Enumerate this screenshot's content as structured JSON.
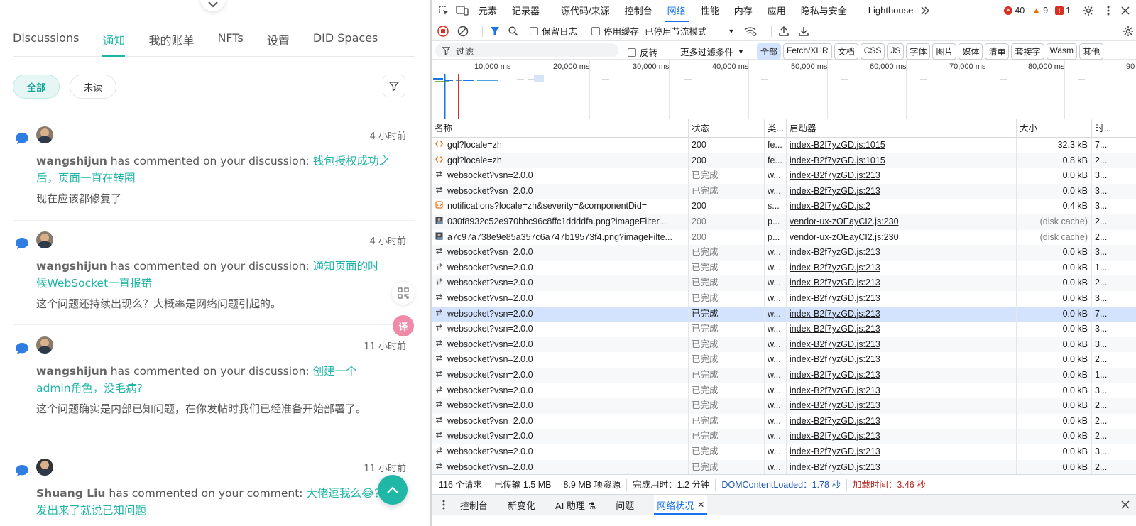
{
  "left": {
    "tabs": [
      "Discussions",
      "通知",
      "我的账单",
      "NFTs",
      "设置",
      "DID Spaces"
    ],
    "filters": {
      "all": "全部",
      "unread": "未读"
    },
    "notifications": [
      {
        "time": "4 小时前",
        "user": "wangshijun",
        "action": " has commented on your discussion: ",
        "link": "钱包授权成功之后，页面一直在转圈",
        "reply": "现在应该都修复了"
      },
      {
        "time": "4 小时前",
        "user": "wangshijun",
        "action": " has commented on your discussion: ",
        "link": "通知页面的时候WebSocket一直报错",
        "reply": "这个问题还持续出现么？大概率是网络问题引起的。"
      },
      {
        "time": "11 小时前",
        "user": "wangshijun",
        "action": " has commented on your discussion: ",
        "link": "创建一个admin角色，没毛病?",
        "reply": "这个问题确实是内部已知问题，在你发帖时我们已经准备开始部署了。"
      },
      {
        "time": "11 小时前",
        "user": "Shuang Liu",
        "action": " has commented on your comment: ",
        "link": "大佬逗我么😂？发出来了就说已知问题",
        "reply": ""
      }
    ],
    "translate_label": "译"
  },
  "devtools": {
    "tabs": [
      "元素",
      "记录器",
      "源代码/来源",
      "控制台",
      "网络",
      "性能",
      "内存",
      "应用",
      "隐私与安全",
      "Lighthouse"
    ],
    "active_tab": "网络",
    "badges": {
      "errors": "40",
      "warnings": "9",
      "issues": "1"
    },
    "toolbar2": {
      "preserve_log": "保留日志",
      "disable_cache": "停用缓存",
      "throttle": "已停用节流模式"
    },
    "filter": {
      "placeholder": "过滤",
      "invert": "反转",
      "more_filters": "更多过滤条件"
    },
    "filter_types": [
      "全部",
      "Fetch/XHR",
      "文档",
      "CSS",
      "JS",
      "字体",
      "图片",
      "媒体",
      "清单",
      "套接字",
      "Wasm",
      "其他"
    ],
    "timeline_ticks": [
      "10,000 ms",
      "20,000 ms",
      "30,000 ms",
      "40,000 ms",
      "50,000 ms",
      "60,000 ms",
      "70,000 ms",
      "80,000 ms",
      "90"
    ],
    "columns": [
      "名称",
      "状态",
      "类...",
      "启动器",
      "大小",
      "时..."
    ],
    "rows": [
      {
        "icon": "fetch",
        "name": "gql?locale=zh",
        "status": "200",
        "type": "fe...",
        "initiator": "index-B2f7yzGD.js:1015",
        "size": "32.3 kB",
        "time": "7..."
      },
      {
        "icon": "fetch",
        "name": "gql?locale=zh",
        "status": "200",
        "type": "fe...",
        "initiator": "index-B2f7yzGD.js:1015",
        "size": "0.8 kB",
        "time": "2..."
      },
      {
        "icon": "ws",
        "name": "websocket?vsn=2.0.0",
        "status": "已完成",
        "type": "w...",
        "initiator": "index-B2f7yzGD.js:213",
        "size": "0.0 kB",
        "time": "3..."
      },
      {
        "icon": "ws",
        "name": "websocket?vsn=2.0.0",
        "status": "已完成",
        "type": "w...",
        "initiator": "index-B2f7yzGD.js:213",
        "size": "0.0 kB",
        "time": "3..."
      },
      {
        "icon": "script",
        "name": "notifications?locale=zh&severity=&componentDid=",
        "status": "200",
        "type": "s...",
        "initiator": "index-B2f7yzGD.js:2",
        "size": "0.4 kB",
        "time": "3..."
      },
      {
        "icon": "img",
        "name": "030f8932c52e970bbc96c8ffc1ddddfa.png?imageFilter...",
        "status": "200",
        "type": "p...",
        "initiator": "vendor-ux-zOEayCI2.js:230",
        "size": "(disk cache)",
        "time": "2..."
      },
      {
        "icon": "img",
        "name": "a7c97a738e9e85a357c6a747b19573f4.png?imageFilte...",
        "status": "200",
        "type": "p...",
        "initiator": "vendor-ux-zOEayCI2.js:230",
        "size": "(disk cache)",
        "time": "2..."
      },
      {
        "icon": "ws",
        "name": "websocket?vsn=2.0.0",
        "status": "已完成",
        "type": "w...",
        "initiator": "index-B2f7yzGD.js:213",
        "size": "0.0 kB",
        "time": "3..."
      },
      {
        "icon": "ws",
        "name": "websocket?vsn=2.0.0",
        "status": "已完成",
        "type": "w...",
        "initiator": "index-B2f7yzGD.js:213",
        "size": "0.0 kB",
        "time": "1..."
      },
      {
        "icon": "ws",
        "name": "websocket?vsn=2.0.0",
        "status": "已完成",
        "type": "w...",
        "initiator": "index-B2f7yzGD.js:213",
        "size": "0.0 kB",
        "time": "2..."
      },
      {
        "icon": "ws",
        "name": "websocket?vsn=2.0.0",
        "status": "已完成",
        "type": "w...",
        "initiator": "index-B2f7yzGD.js:213",
        "size": "0.0 kB",
        "time": "3..."
      },
      {
        "icon": "ws",
        "name": "websocket?vsn=2.0.0",
        "status": "已完成",
        "type": "w...",
        "initiator": "index-B2f7yzGD.js:213",
        "size": "0.0 kB",
        "time": "7..."
      },
      {
        "icon": "ws",
        "name": "websocket?vsn=2.0.0",
        "status": "已完成",
        "type": "w...",
        "initiator": "index-B2f7yzGD.js:213",
        "size": "0.0 kB",
        "time": "3..."
      },
      {
        "icon": "ws",
        "name": "websocket?vsn=2.0.0",
        "status": "已完成",
        "type": "w...",
        "initiator": "index-B2f7yzGD.js:213",
        "size": "0.0 kB",
        "time": "3..."
      },
      {
        "icon": "ws",
        "name": "websocket?vsn=2.0.0",
        "status": "已完成",
        "type": "w...",
        "initiator": "index-B2f7yzGD.js:213",
        "size": "0.0 kB",
        "time": "2..."
      },
      {
        "icon": "ws",
        "name": "websocket?vsn=2.0.0",
        "status": "已完成",
        "type": "w...",
        "initiator": "index-B2f7yzGD.js:213",
        "size": "0.0 kB",
        "time": "1..."
      },
      {
        "icon": "ws",
        "name": "websocket?vsn=2.0.0",
        "status": "已完成",
        "type": "w...",
        "initiator": "index-B2f7yzGD.js:213",
        "size": "0.0 kB",
        "time": "3..."
      },
      {
        "icon": "ws",
        "name": "websocket?vsn=2.0.0",
        "status": "已完成",
        "type": "w...",
        "initiator": "index-B2f7yzGD.js:213",
        "size": "0.0 kB",
        "time": "2..."
      },
      {
        "icon": "ws",
        "name": "websocket?vsn=2.0.0",
        "status": "已完成",
        "type": "w...",
        "initiator": "index-B2f7yzGD.js:213",
        "size": "0.0 kB",
        "time": "2..."
      },
      {
        "icon": "ws",
        "name": "websocket?vsn=2.0.0",
        "status": "已完成",
        "type": "w...",
        "initiator": "index-B2f7yzGD.js:213",
        "size": "0.0 kB",
        "time": "2..."
      },
      {
        "icon": "ws",
        "name": "websocket?vsn=2.0.0",
        "status": "已完成",
        "type": "w...",
        "initiator": "index-B2f7yzGD.js:213",
        "size": "0.0 kB",
        "time": "3..."
      },
      {
        "icon": "ws",
        "name": "websocket?vsn=2.0.0",
        "status": "已完成",
        "type": "w...",
        "initiator": "index-B2f7yzGD.js:213",
        "size": "0.0 kB",
        "time": "2..."
      }
    ],
    "selected_row": 11,
    "summary": {
      "requests": "116 个请求",
      "transferred": "已传输 1.5 MB",
      "resources": "8.9 MB 项资源",
      "finish": "完成用时：1.2 分钟",
      "dcl": "DOMContentLoaded：1.78 秒",
      "load": "加载时间：3.46 秒"
    },
    "drawer_tabs": [
      "控制台",
      "新变化",
      "AI 助理 ⚗",
      "问题",
      "网络状况"
    ],
    "drawer_active": "网络状况"
  }
}
